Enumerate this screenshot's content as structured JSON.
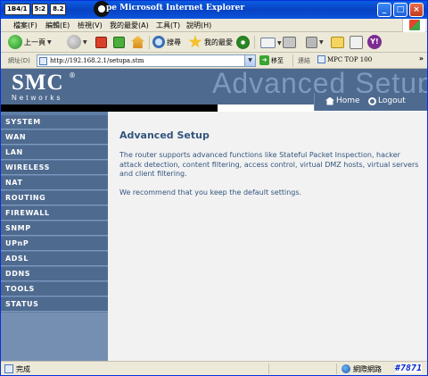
{
  "window": {
    "title": "pe Microsoft Internet Explorer",
    "title_prefix_boxes": [
      "1B4/1",
      "5:2",
      "8.2"
    ],
    "buttons": {
      "minimize": "_",
      "maximize": "□",
      "close": "×"
    }
  },
  "menubar": {
    "items": [
      "檔案(F)",
      "編輯(E)",
      "檢視(V)",
      "我的最愛(A)",
      "工具(T)",
      "說明(H)"
    ]
  },
  "toolbar": {
    "back_label": "上一頁",
    "search_label": "搜尋",
    "favorites_label": "我的最愛"
  },
  "addressbar": {
    "label": "網址(D)",
    "url": "http://192.168.2.1/setupa.stm",
    "go_label": "移至",
    "links_label": "連結",
    "link_item": "MPC TOP 100",
    "chevron": "»"
  },
  "router": {
    "brand": "SMC",
    "brand_reg": "®",
    "brand_sub": "Networks",
    "banner_text": "Advanced Setup",
    "home_label": "Home",
    "logout_label": "Logout",
    "nav": [
      "SYSTEM",
      "WAN",
      "LAN",
      "WIRELESS",
      "NAT",
      "ROUTING",
      "FIREWALL",
      "SNMP",
      "UPnP",
      "ADSL",
      "DDNS",
      "TOOLS",
      "STATUS"
    ],
    "main_title": "Advanced Setup",
    "main_p1": "The router supports advanced functions like Stateful Packet Inspection, hacker attack detection, content filtering, access control, virtual DMZ hosts, virtual servers and client filtering.",
    "main_p2": "We recommend that you keep the default settings."
  },
  "statusbar": {
    "text": "完成",
    "zone": "網際網路",
    "corner_id": "#7871"
  }
}
